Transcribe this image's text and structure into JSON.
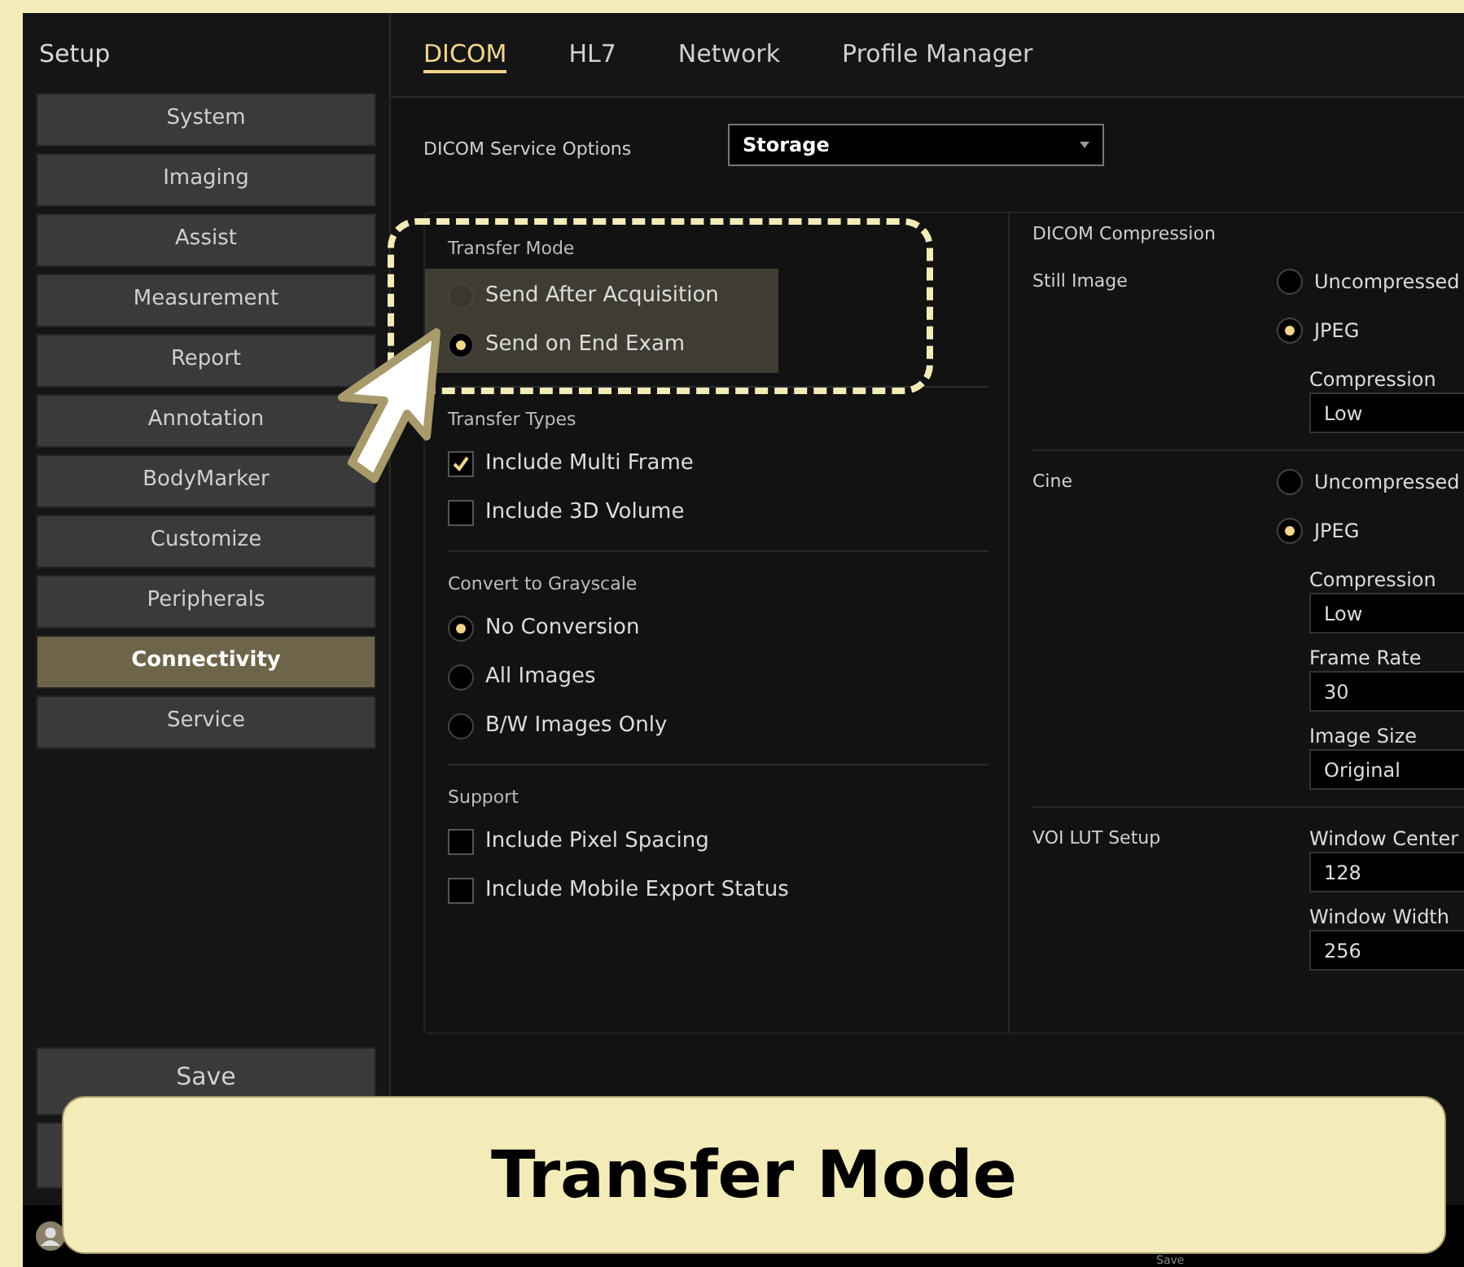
{
  "sidebar": {
    "title": "Setup",
    "items": [
      {
        "label": "System",
        "selected": false
      },
      {
        "label": "Imaging",
        "selected": false
      },
      {
        "label": "Assist",
        "selected": false
      },
      {
        "label": "Measurement",
        "selected": false
      },
      {
        "label": "Report",
        "selected": false
      },
      {
        "label": "Annotation",
        "selected": false
      },
      {
        "label": "BodyMarker",
        "selected": false
      },
      {
        "label": "Customize",
        "selected": false
      },
      {
        "label": "Peripherals",
        "selected": false
      },
      {
        "label": "Connectivity",
        "selected": true
      },
      {
        "label": "Service",
        "selected": false
      }
    ],
    "save_button": "Save"
  },
  "tabs": [
    {
      "label": "DICOM",
      "selected": true
    },
    {
      "label": "HL7",
      "selected": false
    },
    {
      "label": "Network",
      "selected": false
    },
    {
      "label": "Profile Manager",
      "selected": false
    }
  ],
  "service_options": {
    "label": "DICOM Service Options",
    "value": "Storage"
  },
  "left_sections": [
    {
      "title": "Transfer Mode",
      "highlighted": true,
      "options": [
        {
          "kind": "radio",
          "label": "Send After Acquisition",
          "selected": false
        },
        {
          "kind": "radio",
          "label": "Send on End Exam",
          "selected": true
        }
      ]
    },
    {
      "title": "Transfer Types",
      "highlighted": false,
      "options": [
        {
          "kind": "checkbox",
          "label": "Include Multi Frame",
          "checked": true
        },
        {
          "kind": "checkbox",
          "label": "Include 3D Volume",
          "checked": false
        }
      ]
    },
    {
      "title": "Convert to Grayscale",
      "highlighted": false,
      "options": [
        {
          "kind": "radio",
          "label": "No Conversion",
          "selected": true
        },
        {
          "kind": "radio",
          "label": "All Images",
          "selected": false
        },
        {
          "kind": "radio",
          "label": "B/W Images Only",
          "selected": false
        }
      ]
    },
    {
      "title": "Support",
      "highlighted": false,
      "options": [
        {
          "kind": "checkbox",
          "label": "Include Pixel Spacing",
          "checked": false
        },
        {
          "kind": "checkbox",
          "label": "Include Mobile Export Status",
          "checked": false
        }
      ]
    }
  ],
  "compression": {
    "title": "DICOM Compression",
    "rows": [
      {
        "label": "Still Image",
        "options": [
          {
            "label": "Uncompressed",
            "selected": false
          },
          {
            "label": "JPEG",
            "selected": true
          }
        ],
        "fields": [
          {
            "label": "Compression",
            "value": "Low"
          }
        ]
      },
      {
        "label": "Cine",
        "options": [
          {
            "label": "Uncompressed",
            "selected": false
          },
          {
            "label": "JPEG",
            "selected": true
          }
        ],
        "fields": [
          {
            "label": "Compression",
            "value": "Low"
          },
          {
            "label": "Frame Rate",
            "value": "30"
          },
          {
            "label": "Image Size",
            "value": "Original"
          }
        ]
      },
      {
        "label": "VOI LUT Setup",
        "options": [],
        "fields": [
          {
            "label": "Window Center",
            "value": "128"
          },
          {
            "label": "Window Width",
            "value": "256"
          }
        ]
      }
    ]
  },
  "footer_label": "Save",
  "callout": {
    "title": "Transfer Mode"
  }
}
